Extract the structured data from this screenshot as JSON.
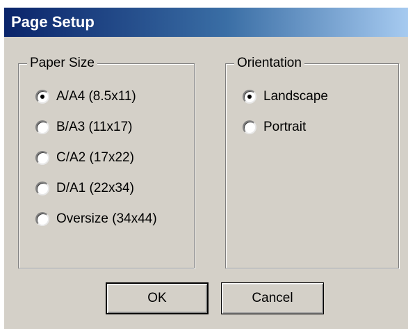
{
  "dialog": {
    "title": "Page Setup",
    "paper_size": {
      "legend": "Paper Size",
      "options": [
        {
          "label": "A/A4 (8.5x11)",
          "checked": true
        },
        {
          "label": "B/A3 (11x17)",
          "checked": false
        },
        {
          "label": "C/A2 (17x22)",
          "checked": false
        },
        {
          "label": "D/A1 (22x34)",
          "checked": false
        },
        {
          "label": "Oversize (34x44)",
          "checked": false
        }
      ]
    },
    "orientation": {
      "legend": "Orientation",
      "options": [
        {
          "label": "Landscape",
          "checked": true
        },
        {
          "label": "Portrait",
          "checked": false
        }
      ]
    },
    "buttons": {
      "ok": "OK",
      "cancel": "Cancel"
    }
  }
}
